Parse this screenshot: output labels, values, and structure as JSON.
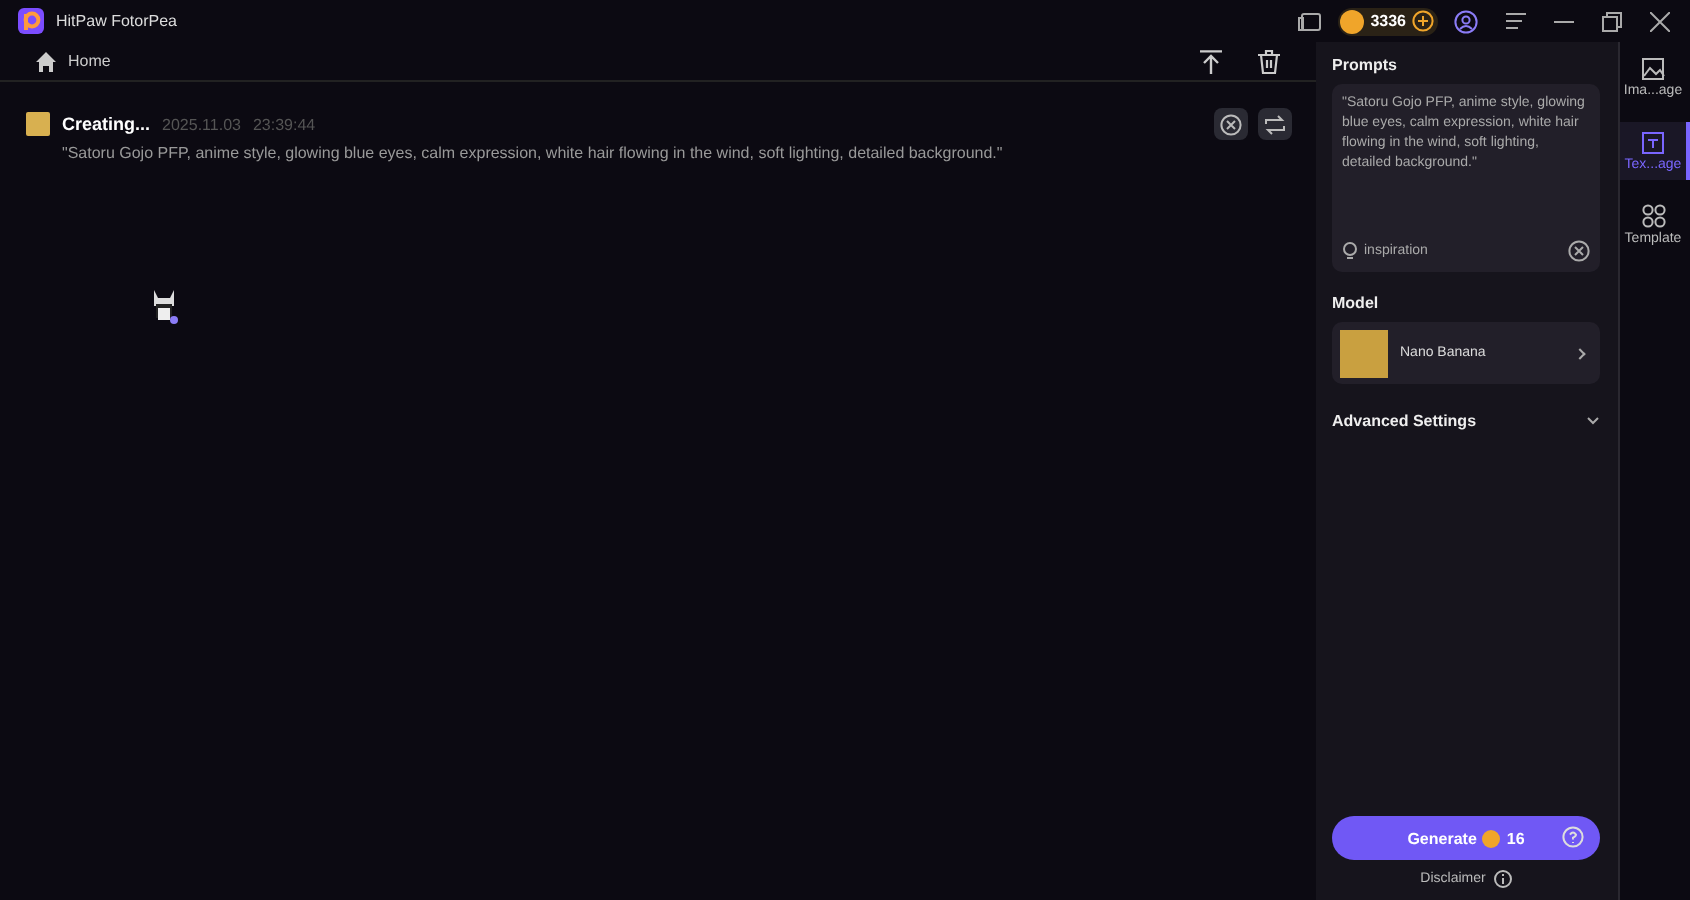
{
  "window": {
    "title": "HitPaw FotorPea",
    "credits": "3336"
  },
  "breadcrumb": {
    "label": "Home"
  },
  "task": {
    "status": "Creating...",
    "date": "2025.11.03",
    "time": "23:39:44",
    "prompt": "\"Satoru Gojo PFP, anime style, glowing blue eyes, calm expression, white hair flowing in the wind, soft lighting, detailed background.\""
  },
  "panel": {
    "prompts_title": "Prompts",
    "prompt_value": "\"Satoru Gojo PFP, anime style, glowing blue eyes, calm expression, white hair flowing in the wind, soft lighting, detailed background.\"",
    "inspiration": "inspiration",
    "model_title": "Model",
    "model_name": "Nano Banana",
    "advanced": "Advanced Settings",
    "generate": "Generate",
    "cost": "16",
    "disclaimer": "Disclaimer"
  },
  "rail": [
    {
      "label": "Ima...age",
      "kind": "image",
      "selected": false
    },
    {
      "label": "Tex...age",
      "kind": "text",
      "selected": true
    },
    {
      "label": "Template",
      "kind": "template",
      "selected": false
    }
  ]
}
